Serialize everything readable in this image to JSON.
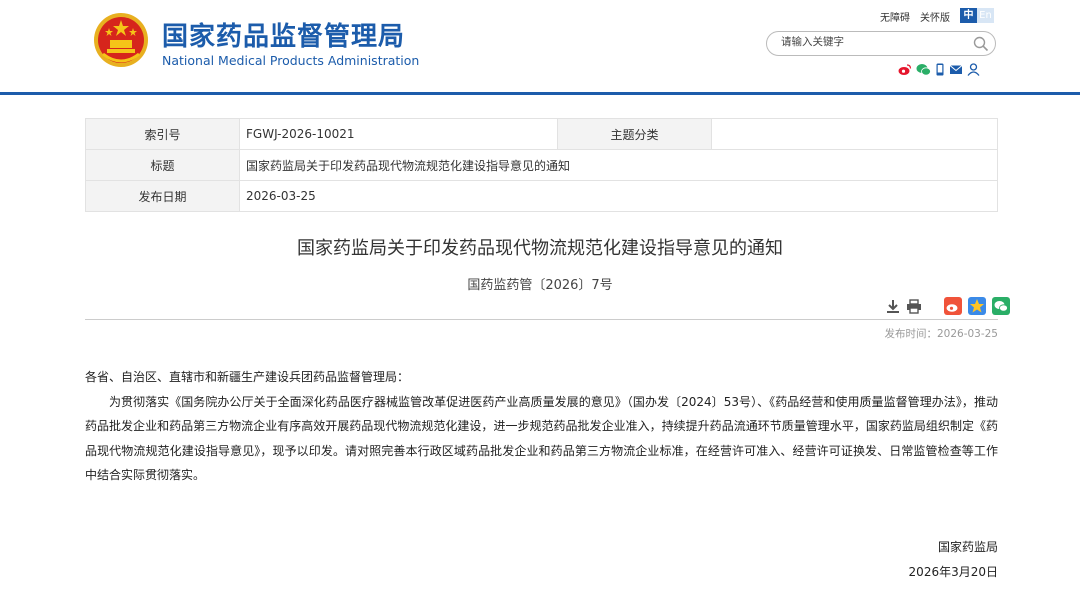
{
  "header": {
    "title_cn": "国家药品监督管理局",
    "title_en": "National Medical Products Administration",
    "accessibility_link": "无障碍",
    "care_mode_link": "关怀版",
    "lang_cn": "中",
    "lang_en": "En",
    "search_placeholder": "请输入关键字",
    "social_icons": [
      "weibo-icon",
      "wechat-icon",
      "mobile-icon",
      "mail-icon",
      "user-icon"
    ],
    "brand_color": "#1c5cab"
  },
  "meta_table": {
    "index_label": "索引号",
    "index_value": "FGWJ-2026-10021",
    "category_label": "主题分类",
    "category_value": "",
    "title_label": "标题",
    "title_value": "国家药监局关于印发药品现代物流规范化建设指导意见的通知",
    "date_label": "发布日期",
    "date_value": "2026-03-25"
  },
  "article": {
    "title": "国家药监局关于印发药品现代物流规范化建设指导意见的通知",
    "doc_number": "国药监药管〔2026〕7号",
    "tools": [
      "download-icon",
      "print-icon",
      "weibo-share-icon",
      "qzone-share-icon",
      "wechat-share-icon"
    ],
    "publish_time_label": "发布时间：",
    "publish_time": "2026-03-25",
    "salutation": "各省、自治区、直辖市和新疆生产建设兵团药品监督管理局：",
    "paragraph": "为贯彻落实《国务院办公厅关于全面深化药品医疗器械监管改革促进医药产业高质量发展的意见》（国办发〔2024〕53号）、《药品经营和使用质量监督管理办法》，推动药品批发企业和药品第三方物流企业有序高效开展药品现代物流规范化建设，进一步规范药品批发企业准入，持续提升药品流通环节质量管理水平，国家药监局组织制定《药品现代物流规范化建设指导意见》，现予以印发。请对照完善本行政区域药品批发企业和药品第三方物流企业标准，在经营许可准入、经营许可证换发、日常监管检查等工作中结合实际贯彻落实。",
    "signature": "国家药监局",
    "sign_date": "2026年3月20日"
  }
}
